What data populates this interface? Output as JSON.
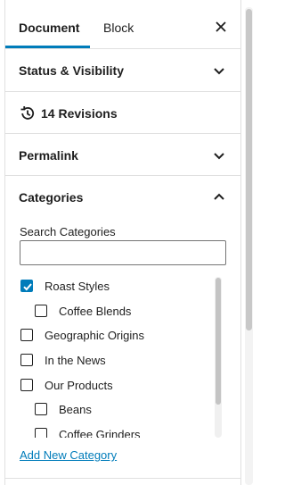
{
  "tabs": {
    "document_label": "Document",
    "block_label": "Block",
    "close_icon": "close-icon"
  },
  "panels": {
    "status": {
      "title": "Status & Visibility",
      "state": "collapsed"
    },
    "revisions": {
      "title": "14 Revisions",
      "icon": "history-icon"
    },
    "permalink": {
      "title": "Permalink",
      "state": "collapsed"
    },
    "categories": {
      "title": "Categories",
      "state": "expanded"
    }
  },
  "categories": {
    "search_label": "Search Categories",
    "search_value": "",
    "items": [
      {
        "label": "Roast Styles",
        "checked": true,
        "level": 0
      },
      {
        "label": "Coffee Blends",
        "checked": false,
        "level": 1
      },
      {
        "label": "Geographic Origins",
        "checked": false,
        "level": 0
      },
      {
        "label": "In the News",
        "checked": false,
        "level": 0
      },
      {
        "label": "Our Products",
        "checked": false,
        "level": 0
      },
      {
        "label": "Beans",
        "checked": false,
        "level": 1
      },
      {
        "label": "Coffee Grinders",
        "checked": false,
        "level": 1
      }
    ],
    "add_new_label": "Add New Category"
  },
  "colors": {
    "accent": "#007cba",
    "text": "#1e1e1e",
    "border": "#e0e0e0"
  }
}
